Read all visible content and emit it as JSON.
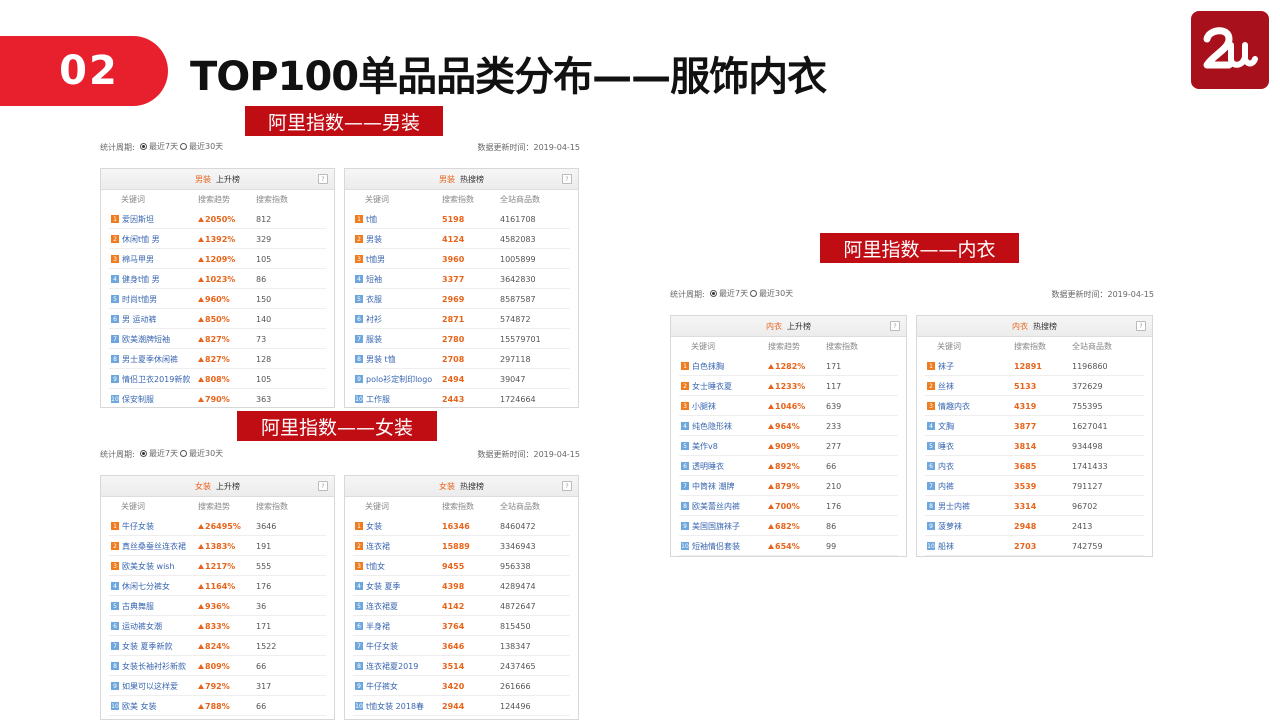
{
  "slide_number": "02",
  "title": "TOP100单品品类分布——服饰内衣",
  "banners": {
    "men": "阿里指数——男装",
    "women": "阿里指数——女装",
    "underwear": "阿里指数——内衣"
  },
  "meta": {
    "period_label": "统计周期:",
    "option_7": "最近7天",
    "option_30": "最近30天",
    "update_time": "数据更新时间：2019-04-15"
  },
  "up_headers": [
    "关键词",
    "搜索趋势",
    "搜索指数"
  ],
  "hot_headers": [
    "关键词",
    "搜索指数",
    "全站商品数"
  ],
  "men": {
    "up_title": {
      "cat": "男装",
      "name": "上升榜"
    },
    "hot_title": {
      "cat": "男装",
      "name": "热搜榜"
    },
    "up_rows": [
      {
        "rank": "1",
        "kw": "爱因斯坦",
        "trend": "2050%",
        "idx": "812"
      },
      {
        "rank": "2",
        "kw": "休闲t恤 男",
        "trend": "1392%",
        "idx": "329"
      },
      {
        "rank": "3",
        "kw": "棉马甲男",
        "trend": "1209%",
        "idx": "105"
      },
      {
        "rank": "4",
        "kw": "健身t恤 男",
        "trend": "1023%",
        "idx": "86"
      },
      {
        "rank": "5",
        "kw": "时尚t恤男",
        "trend": "960%",
        "idx": "150"
      },
      {
        "rank": "6",
        "kw": "男 运动裤",
        "trend": "850%",
        "idx": "140"
      },
      {
        "rank": "7",
        "kw": "欧美潮牌短袖",
        "trend": "827%",
        "idx": "73"
      },
      {
        "rank": "8",
        "kw": "男士夏季休闲裤",
        "trend": "827%",
        "idx": "128"
      },
      {
        "rank": "9",
        "kw": "情侣卫衣2019新款",
        "trend": "808%",
        "idx": "105"
      },
      {
        "rank": "10",
        "kw": "保安制服",
        "trend": "790%",
        "idx": "363"
      }
    ],
    "hot_rows": [
      {
        "rank": "1",
        "kw": "t恤",
        "idx": "5198",
        "count": "4161708"
      },
      {
        "rank": "2",
        "kw": "男装",
        "idx": "4124",
        "count": "4582083"
      },
      {
        "rank": "3",
        "kw": "t恤男",
        "idx": "3960",
        "count": "1005899"
      },
      {
        "rank": "4",
        "kw": "短袖",
        "idx": "3377",
        "count": "3642830"
      },
      {
        "rank": "5",
        "kw": "衣服",
        "idx": "2969",
        "count": "8587587"
      },
      {
        "rank": "6",
        "kw": "衬衫",
        "idx": "2871",
        "count": "574872"
      },
      {
        "rank": "7",
        "kw": "服装",
        "idx": "2780",
        "count": "15579701"
      },
      {
        "rank": "8",
        "kw": "男装 t恤",
        "idx": "2708",
        "count": "297118"
      },
      {
        "rank": "9",
        "kw": "polo衫定制印logo",
        "idx": "2494",
        "count": "39047"
      },
      {
        "rank": "10",
        "kw": "工作服",
        "idx": "2443",
        "count": "1724664"
      }
    ]
  },
  "women": {
    "up_title": {
      "cat": "女装",
      "name": "上升榜"
    },
    "hot_title": {
      "cat": "女装",
      "name": "热搜榜"
    },
    "up_rows": [
      {
        "rank": "1",
        "kw": "牛仔女装",
        "trend": "26495%",
        "idx": "3646"
      },
      {
        "rank": "2",
        "kw": "真丝桑蚕丝连衣裙",
        "trend": "1383%",
        "idx": "191"
      },
      {
        "rank": "3",
        "kw": "欧美女装 wish",
        "trend": "1217%",
        "idx": "555"
      },
      {
        "rank": "4",
        "kw": "休闲七分裤女",
        "trend": "1164%",
        "idx": "176"
      },
      {
        "rank": "5",
        "kw": "古典舞服",
        "trend": "936%",
        "idx": "36"
      },
      {
        "rank": "6",
        "kw": "运动裤女潮",
        "trend": "833%",
        "idx": "171"
      },
      {
        "rank": "7",
        "kw": "女装 夏季新款",
        "trend": "824%",
        "idx": "1522"
      },
      {
        "rank": "8",
        "kw": "女装长袖衬衫新款",
        "trend": "809%",
        "idx": "66"
      },
      {
        "rank": "9",
        "kw": "如果可以这样爱",
        "trend": "792%",
        "idx": "317"
      },
      {
        "rank": "10",
        "kw": "欧美 女装",
        "trend": "788%",
        "idx": "66"
      }
    ],
    "hot_rows": [
      {
        "rank": "1",
        "kw": "女装",
        "idx": "16346",
        "count": "8460472"
      },
      {
        "rank": "2",
        "kw": "连衣裙",
        "idx": "15889",
        "count": "3346943"
      },
      {
        "rank": "3",
        "kw": "t恤女",
        "idx": "9455",
        "count": "956338"
      },
      {
        "rank": "4",
        "kw": "女装 夏季",
        "idx": "4398",
        "count": "4289474"
      },
      {
        "rank": "5",
        "kw": "连衣裙夏",
        "idx": "4142",
        "count": "4872647"
      },
      {
        "rank": "6",
        "kw": "半身裙",
        "idx": "3764",
        "count": "815450"
      },
      {
        "rank": "7",
        "kw": "牛仔女装",
        "idx": "3646",
        "count": "138347"
      },
      {
        "rank": "8",
        "kw": "连衣裙夏2019",
        "idx": "3514",
        "count": "2437465"
      },
      {
        "rank": "9",
        "kw": "牛仔裤女",
        "idx": "3420",
        "count": "261666"
      },
      {
        "rank": "10",
        "kw": "t恤女装 2018春",
        "idx": "2944",
        "count": "124496"
      }
    ]
  },
  "underwear": {
    "up_title": {
      "cat": "内衣",
      "name": "上升榜"
    },
    "hot_title": {
      "cat": "内衣",
      "name": "热搜榜"
    },
    "up_rows": [
      {
        "rank": "1",
        "kw": "白色抹胸",
        "trend": "1282%",
        "idx": "171"
      },
      {
        "rank": "2",
        "kw": "女士睡衣夏",
        "trend": "1233%",
        "idx": "117"
      },
      {
        "rank": "3",
        "kw": "小腿袜",
        "trend": "1046%",
        "idx": "639"
      },
      {
        "rank": "4",
        "kw": "纯色隐形袜",
        "trend": "964%",
        "idx": "233"
      },
      {
        "rank": "5",
        "kw": "美作v8",
        "trend": "909%",
        "idx": "277"
      },
      {
        "rank": "6",
        "kw": "透明睡衣",
        "trend": "892%",
        "idx": "66"
      },
      {
        "rank": "7",
        "kw": "中筒袜 潮牌",
        "trend": "879%",
        "idx": "210"
      },
      {
        "rank": "8",
        "kw": "欧美蕾丝内裤",
        "trend": "700%",
        "idx": "176"
      },
      {
        "rank": "9",
        "kw": "美国国旗袜子",
        "trend": "682%",
        "idx": "86"
      },
      {
        "rank": "10",
        "kw": "短袖情侣套装",
        "trend": "654%",
        "idx": "99"
      }
    ],
    "hot_rows": [
      {
        "rank": "1",
        "kw": "袜子",
        "idx": "12891",
        "count": "1196860"
      },
      {
        "rank": "2",
        "kw": "丝袜",
        "idx": "5133",
        "count": "372629"
      },
      {
        "rank": "3",
        "kw": "情趣内衣",
        "idx": "4319",
        "count": "755395"
      },
      {
        "rank": "4",
        "kw": "文胸",
        "idx": "3877",
        "count": "1627041"
      },
      {
        "rank": "5",
        "kw": "睡衣",
        "idx": "3814",
        "count": "934498"
      },
      {
        "rank": "6",
        "kw": "内衣",
        "idx": "3685",
        "count": "1741433"
      },
      {
        "rank": "7",
        "kw": "内裤",
        "idx": "3539",
        "count": "791127"
      },
      {
        "rank": "8",
        "kw": "男士内裤",
        "idx": "3314",
        "count": "96702"
      },
      {
        "rank": "9",
        "kw": "菠萝袜",
        "idx": "2948",
        "count": "2413"
      },
      {
        "rank": "10",
        "kw": "船袜",
        "idx": "2703",
        "count": "742759"
      }
    ]
  }
}
